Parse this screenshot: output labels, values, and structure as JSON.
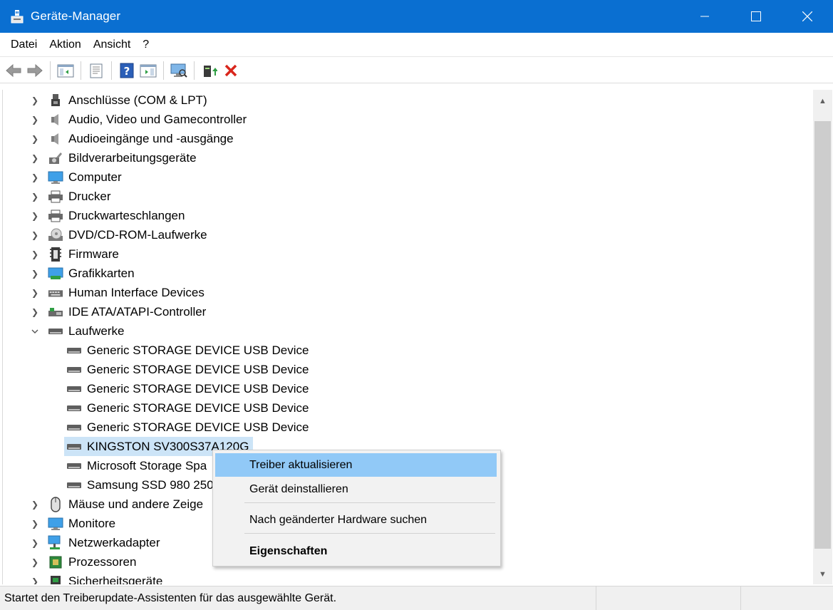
{
  "window": {
    "title": "Geräte-Manager"
  },
  "menu": {
    "items": [
      "Datei",
      "Aktion",
      "Ansicht",
      "?"
    ]
  },
  "toolbar": {
    "buttons": [
      "back-arrow-icon",
      "forward-arrow-icon",
      "console-tree-icon",
      "properties-sheet-icon",
      "help-icon",
      "action-pane-icon",
      "scan-hardware-icon",
      "update-driver-icon",
      "uninstall-icon"
    ]
  },
  "tree": {
    "categories_top": [
      "Anschlüsse (COM & LPT)",
      "Audio, Video und Gamecontroller",
      "Audioeingänge und -ausgänge",
      "Bildverarbeitungsgeräte",
      "Computer",
      "Drucker",
      "Druckwarteschlangen",
      "DVD/CD-ROM-Laufwerke",
      "Firmware",
      "Grafikkarten",
      "Human Interface Devices",
      "IDE ATA/ATAPI-Controller"
    ],
    "expanded_category": "Laufwerke",
    "drives": [
      "Generic STORAGE DEVICE USB Device",
      "Generic STORAGE DEVICE USB Device",
      "Generic STORAGE DEVICE USB Device",
      "Generic STORAGE DEVICE USB Device",
      "Generic STORAGE DEVICE USB Device",
      "KINGSTON SV300S37A120G",
      "Microsoft Storage Spa",
      "Samsung SSD 980 250"
    ],
    "selected_drive": "KINGSTON SV300S37A120G",
    "categories_bottom": [
      "Mäuse und andere Zeige",
      "Monitore",
      "Netzwerkadapter",
      "Prozessoren",
      "Sicherheitsgeräte"
    ]
  },
  "context_menu": {
    "update_driver": "Treiber aktualisieren",
    "uninstall": "Gerät deinstallieren",
    "scan": "Nach geänderter Hardware suchen",
    "properties": "Eigenschaften"
  },
  "status": {
    "text": "Startet den Treiberupdate-Assistenten für das ausgewählte Gerät."
  },
  "colors": {
    "titlebar": "#0a6fd1",
    "selection": "#cce4f7",
    "menu_highlight": "#91c9f7",
    "uninstall_red": "#d9261c"
  }
}
